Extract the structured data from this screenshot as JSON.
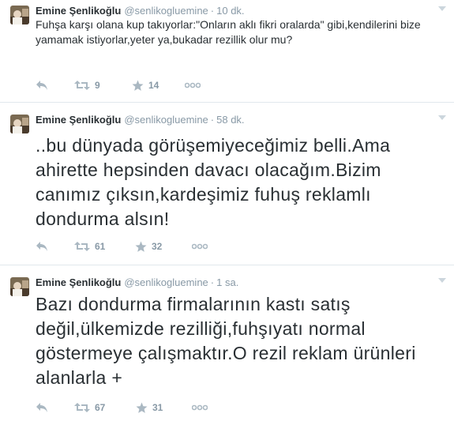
{
  "user": {
    "name": "Emine Şenlikoğlu",
    "handle": "@senlikogluemine",
    "separator": "·"
  },
  "tweets": [
    {
      "time": "10 dk.",
      "text": "Fuhşa karşı olana kup takıyorlar:\"Onların aklı fikri oralarda\" gibi,kendilerini bize yamamak istiyorlar,yeter ya,bukadar rezillik olur mu?",
      "retweets": "9",
      "favorites": "14"
    },
    {
      "time": "58 dk.",
      "text": "..bu dünyada görüşemiyeceğimiz belli.Ama ahirette hepsinden davacı olacağım.Bizim canımız çıksın,kardeşimiz fuhuş reklamlı dondurma alsın!",
      "retweets": "61",
      "favorites": "32"
    },
    {
      "time": "1 sa.",
      "text": "Bazı dondurma firmalarının kastı satış değil,ülkemizde rezilliği,fuhşıyatı normal göstermeye çalışmaktır.O rezil reklam ürünleri alanlarla +",
      "retweets": "67",
      "favorites": "31"
    }
  ],
  "icons": {
    "reply": "reply-icon",
    "retweet": "retweet-icon",
    "favorite": "star-icon",
    "more": "more-icon",
    "caret": "chevron-down-icon"
  },
  "colors": {
    "text": "#292f33",
    "meta": "#8899a6",
    "icon": "#aab8c2",
    "divider": "#e1e8ed"
  }
}
